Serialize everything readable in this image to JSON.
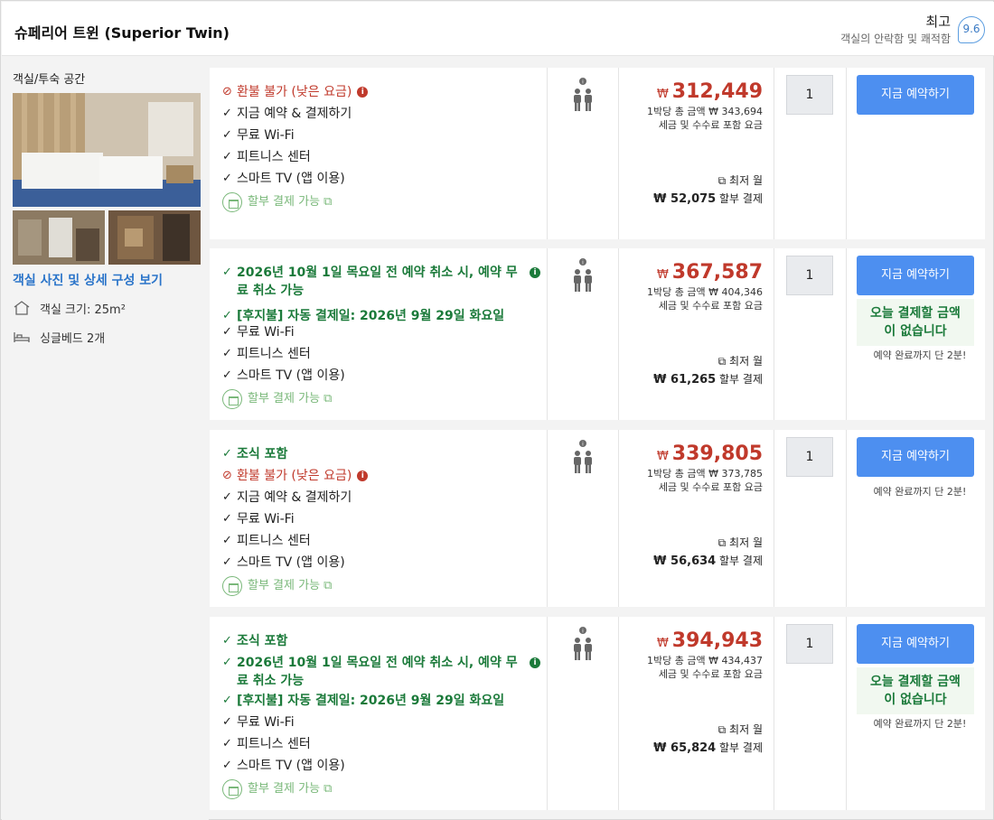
{
  "header": {
    "room_title": "슈페리어 트윈 (Superior Twin)",
    "rating_word": "최고",
    "rating_sub": "객실의 안락함 및 쾌적함",
    "rating_score": "9.6"
  },
  "left_panel": {
    "label": "객실/투숙 공간",
    "photo_link": "객실 사진 및 상세 구성 보기",
    "features": [
      {
        "icon": "house-icon",
        "text": "객실 크기: 25m²"
      },
      {
        "icon": "bed-icon",
        "text": "싱글베드 2개"
      }
    ]
  },
  "common": {
    "book_label": "지금 예약하기",
    "pay_today": "오늘 결제할 금액 이 없습니다",
    "fast_booking": "예약 완료까지 단 2분!",
    "per_night_prefix": "1박당 총 금액",
    "tax_note": "세금 및 수수료 포함 요금",
    "lowest_month": "최저 월",
    "installment_suffix": "할부 결제",
    "currency": "₩"
  },
  "offers": [
    {
      "benefits": [
        {
          "type": "red",
          "text": "환불 불가 (낮은 요금)",
          "info": true
        },
        {
          "type": "black",
          "text": "지금 예약 & 결제하기"
        },
        {
          "type": "black",
          "text": "무료 Wi-Fi"
        },
        {
          "type": "black",
          "text": "피트니스 센터"
        },
        {
          "type": "black",
          "text": "스마트 TV (앱 이용)"
        },
        {
          "type": "inst",
          "text": "할부 결제 가능"
        }
      ],
      "price": "312,449",
      "per_night": "₩ 343,694",
      "installment": "₩ 52,075",
      "qty": "1",
      "pay_later": false
    },
    {
      "benefits": [
        {
          "type": "green",
          "text": "2026년 10월 1일 목요일 전 예약 취소 시, 예약 무료 취소 가능",
          "info": true
        },
        {
          "type": "green",
          "text": "[후지불] 자동 결제일: 2026년 9월 29일 화요일"
        },
        {
          "type": "black",
          "text": "무료 Wi-Fi"
        },
        {
          "type": "black",
          "text": "피트니스 센터"
        },
        {
          "type": "black",
          "text": "스마트 TV (앱 이용)"
        },
        {
          "type": "inst",
          "text": "할부 결제 가능"
        }
      ],
      "price": "367,587",
      "per_night": "₩ 404,346",
      "installment": "₩ 61,265",
      "qty": "1",
      "pay_later": true
    },
    {
      "benefits": [
        {
          "type": "green",
          "text": "조식 포함"
        },
        {
          "type": "red",
          "text": "환불 불가 (낮은 요금)",
          "info": true
        },
        {
          "type": "black",
          "text": "지금 예약 & 결제하기"
        },
        {
          "type": "black",
          "text": "무료 Wi-Fi"
        },
        {
          "type": "black",
          "text": "피트니스 센터"
        },
        {
          "type": "black",
          "text": "스마트 TV (앱 이용)"
        },
        {
          "type": "inst",
          "text": "할부 결제 가능"
        }
      ],
      "price": "339,805",
      "per_night": "₩ 373,785",
      "installment": "₩ 56,634",
      "qty": "1",
      "pay_later": false
    },
    {
      "benefits": [
        {
          "type": "green",
          "text": "조식 포함"
        },
        {
          "type": "green",
          "text": "2026년 10월 1일 목요일 전 예약 취소 시, 예약 무료 취소 가능",
          "info": true
        },
        {
          "type": "green",
          "text": "[후지불] 자동 결제일: 2026년 9월 29일 화요일"
        },
        {
          "type": "black",
          "text": "무료 Wi-Fi"
        },
        {
          "type": "black",
          "text": "피트니스 센터"
        },
        {
          "type": "black",
          "text": "스마트 TV (앱 이용)"
        },
        {
          "type": "inst",
          "text": "할부 결제 가능"
        }
      ],
      "price": "394,943",
      "per_night": "₩ 434,437",
      "installment": "₩ 65,824",
      "qty": "1",
      "pay_later": true
    }
  ]
}
